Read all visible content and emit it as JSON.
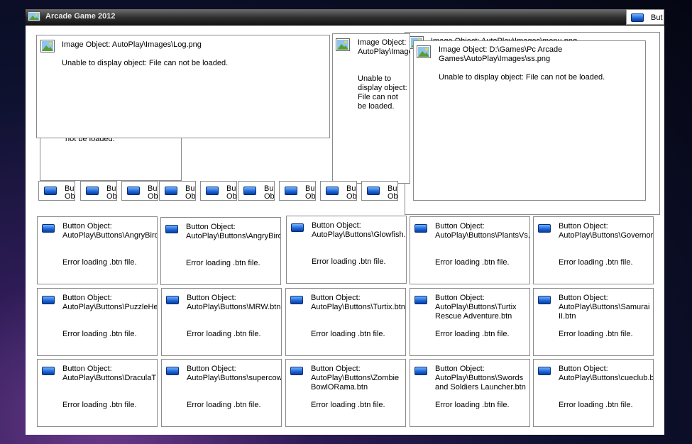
{
  "window": {
    "title": "Arcade Game 2012",
    "corner_button_label": "But"
  },
  "image_objects": [
    {
      "title": "Image Object: AutoPlay\\Images\\Log.png",
      "message": "Unable to display object: File can not be loaded."
    },
    {
      "title": "Image Object: AutoPlay\\Images",
      "message": "Unable to display object: File can not be loaded."
    },
    {
      "title": "Image Object: AutoPlay\\Images\\menu.png",
      "message": ""
    },
    {
      "title": "Image Object: D:\\Games\\Pc Arcade Games\\AutoPlay\\Images\\ss.png",
      "message": "Unable to display object: File can not be loaded."
    }
  ],
  "hidden_fragment": "not be loaded.",
  "small_buttons": [
    {
      "label": "But Obj"
    },
    {
      "label": "But Obj"
    },
    {
      "label": "But Obj"
    },
    {
      "label": "But Obj"
    },
    {
      "label": "But Obj"
    },
    {
      "label": "But Obj"
    },
    {
      "label": "But Obj"
    },
    {
      "label": "But Obj"
    },
    {
      "label": "But Obj"
    }
  ],
  "button_cards": [
    {
      "heading": "Button Object:",
      "path": "AutoPlay\\Buttons\\AngryBirds",
      "error": "Error loading .btn file."
    },
    {
      "heading": "Button Object:",
      "path": "AutoPlay\\Buttons\\AngryBirds",
      "error": "Error loading .btn file."
    },
    {
      "heading": "Button Object:",
      "path": "AutoPlay\\Buttons\\Glowfish.",
      "error": "Error loading .btn file."
    },
    {
      "heading": "Button Object:",
      "path": "AutoPlay\\Buttons\\PlantsVs.",
      "error": "Error loading .btn file."
    },
    {
      "heading": "Button Object:",
      "path": "AutoPlay\\Buttons\\Governor",
      "error": "Error loading .btn file."
    },
    {
      "heading": "Button Object:",
      "path": "AutoPlay\\Buttons\\PuzzleHe",
      "error": "Error loading .btn file."
    },
    {
      "heading": "Button Object:",
      "path": "AutoPlay\\Buttons\\MRW.btn",
      "error": "Error loading .btn file."
    },
    {
      "heading": "Button Object:",
      "path": "AutoPlay\\Buttons\\Turtix.btn",
      "error": "Error loading .btn file."
    },
    {
      "heading": "Button Object:",
      "path": "AutoPlay\\Buttons\\Turtix Rescue Adventure.btn",
      "error": "Error loading .btn file."
    },
    {
      "heading": "Button Object:",
      "path": "AutoPlay\\Buttons\\Samurai II.btn",
      "error": "Error loading .btn file."
    },
    {
      "heading": "Button Object:",
      "path": "AutoPlay\\Buttons\\DraculaT",
      "error": "Error loading .btn file."
    },
    {
      "heading": "Button Object:",
      "path": "AutoPlay\\Buttons\\supercow",
      "error": "Error loading .btn file."
    },
    {
      "heading": "Button Object:",
      "path": "AutoPlay\\Buttons\\Zombie BowlORama.btn",
      "error": "Error loading .btn file."
    },
    {
      "heading": "Button Object:",
      "path": "AutoPlay\\Buttons\\Swords and Soldiers Launcher.btn",
      "error": "Error loading .btn file."
    },
    {
      "heading": "Button Object:",
      "path": "AutoPlay\\Buttons\\cueclub.btn",
      "error": "Error loading .btn file."
    }
  ]
}
